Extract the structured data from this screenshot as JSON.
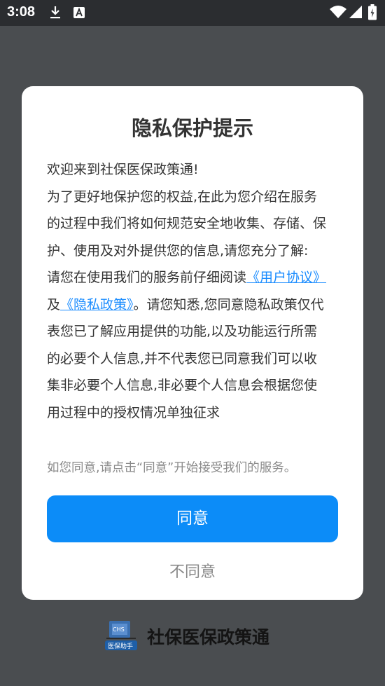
{
  "status_bar": {
    "time": "3:08",
    "left_icons": [
      "download-icon",
      "text-input-icon"
    ],
    "right_icons": [
      "wifi-icon",
      "signal-icon",
      "battery-icon"
    ]
  },
  "dialog": {
    "title": "隐私保护提示",
    "paragraphs": {
      "welcome": "欢迎来到社保医保政策通!",
      "intro": "为了更好地保护您的权益,在此为您介绍在服务的过程中我们将如何规范安全地收集、存储、保护、使用及对外提供您的信息,请您充分了解:",
      "read_before": "请您在使用我们的服务前仔细阅读",
      "user_agreement_link": "《用户协议》",
      "and": "及",
      "privacy_policy_link": "《隐私政策》",
      "read_after": "。请您知悉,您同意隐私政策仅代表您已了解应用提供的功能,以及功能运行所需的必要个人信息,并不代表您已同意我们可以收集非必要个人信息,非必要个人信息会根据您使用过程中的授权情况单独征求"
    },
    "note": "如您同意,请点击“同意”开始接受我们的服务。",
    "agree_label": "同意",
    "disagree_label": "不同意"
  },
  "footer": {
    "app_name": "社保医保政策通",
    "logo_text": "医保助手",
    "logo_badge": "CHS"
  },
  "colors": {
    "accent": "#0c8cf8",
    "link": "#1a8cff",
    "overlay": "#4a4d50",
    "status_bar": "#2b2d30"
  }
}
